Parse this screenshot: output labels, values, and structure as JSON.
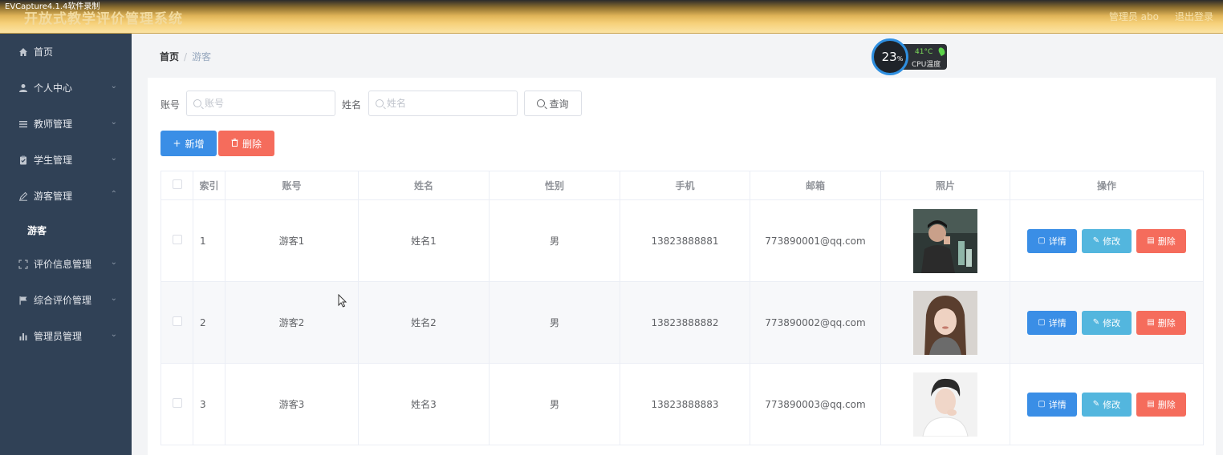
{
  "recorder_label": "EVCapture4.1.4软件录制",
  "header": {
    "title": "开放式教学评价管理系统",
    "admin_label": "管理员 abo",
    "logout_label": "退出登录"
  },
  "sidebar": {
    "items": [
      {
        "label": "首页",
        "icon": "home-icon"
      },
      {
        "label": "个人中心",
        "icon": "user-icon"
      },
      {
        "label": "教师管理",
        "icon": "list-icon"
      },
      {
        "label": "学生管理",
        "icon": "clipboard-icon"
      },
      {
        "label": "游客管理",
        "icon": "edit-icon",
        "expanded": true,
        "children": [
          {
            "label": "游客"
          }
        ]
      },
      {
        "label": "评价信息管理",
        "icon": "fullscreen-icon"
      },
      {
        "label": "综合评价管理",
        "icon": "flag-icon"
      },
      {
        "label": "管理员管理",
        "icon": "bar-chart-icon"
      }
    ]
  },
  "breadcrumb": {
    "home": "首页",
    "separator": "/",
    "current": "游客"
  },
  "cpu_widget": {
    "percent": "23",
    "percent_unit": "%",
    "temp": "41°C",
    "label": "CPU温度"
  },
  "search": {
    "account_label": "账号",
    "account_placeholder": "账号",
    "name_label": "姓名",
    "name_placeholder": "姓名",
    "query_label": "查询"
  },
  "toolbar": {
    "add_label": "新增",
    "delete_label": "删除"
  },
  "table": {
    "headers": [
      "",
      "索引",
      "账号",
      "姓名",
      "性别",
      "手机",
      "邮箱",
      "照片",
      "操作"
    ],
    "rows": [
      {
        "index": "1",
        "account": "游客1",
        "name": "姓名1",
        "gender": "男",
        "phone": "13823888881",
        "email": "773890001@qq.com"
      },
      {
        "index": "2",
        "account": "游客2",
        "name": "姓名2",
        "gender": "男",
        "phone": "13823888882",
        "email": "773890002@qq.com"
      },
      {
        "index": "3",
        "account": "游客3",
        "name": "姓名3",
        "gender": "男",
        "phone": "13823888883",
        "email": "773890003@qq.com"
      }
    ],
    "action_labels": {
      "detail": "详情",
      "edit": "修改",
      "delete": "删除"
    }
  },
  "colors": {
    "sidebar_bg": "#304156",
    "primary": "#3a8ee6",
    "edit": "#53b6de",
    "danger": "#f56c5c"
  }
}
